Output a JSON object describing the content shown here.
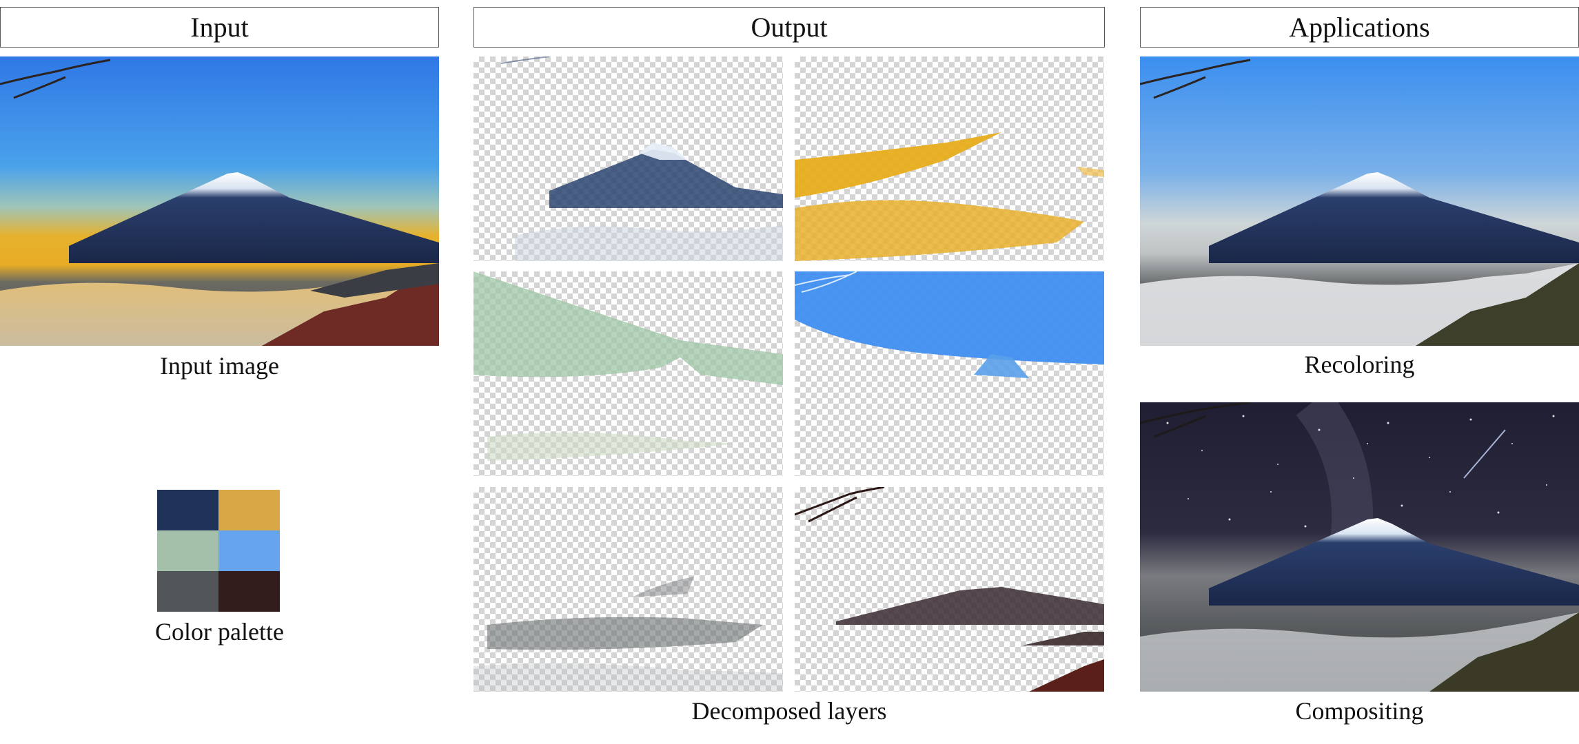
{
  "headers": {
    "input": "Input",
    "output": "Output",
    "applications": "Applications"
  },
  "captions": {
    "input_image": "Input image",
    "color_palette": "Color palette",
    "decomposed_layers": "Decomposed layers",
    "recoloring": "Recoloring",
    "compositing": "Compositing"
  },
  "palette": [
    "#1f3359",
    "#d9a845",
    "#a4bfaa",
    "#66a4ee",
    "#525659",
    "#331d1c"
  ]
}
